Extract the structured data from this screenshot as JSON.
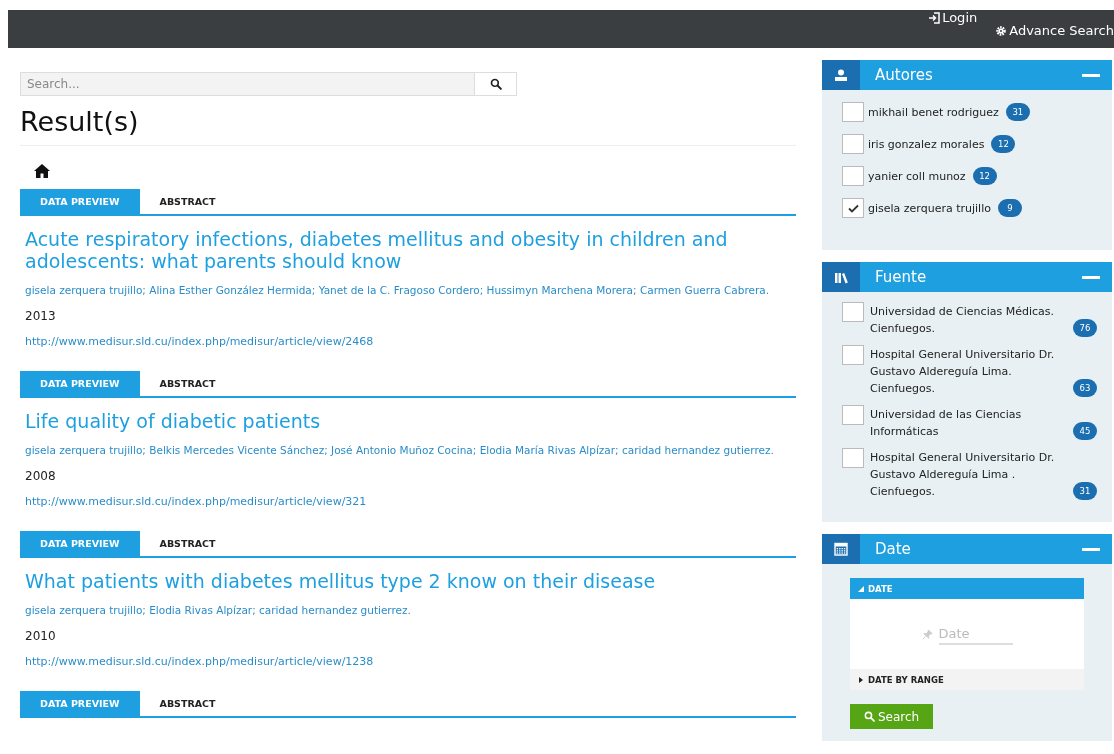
{
  "topbar": {
    "login": "Login",
    "advance_search": "Advance Search"
  },
  "search": {
    "placeholder": "Search..."
  },
  "heading": "Result(s)",
  "results": [
    {
      "tabs": [
        {
          "label": "DATA PREVIEW",
          "selected": true
        },
        {
          "label": "ABSTRACT",
          "selected": false
        }
      ],
      "title": "Acute respiratory infections, diabetes mellitus and obesity in children and adolescents: what parents should know",
      "authors": "gisela zerquera trujillo; Alina Esther González Hermida; Yanet de la C. Fragoso Cordero; Hussimyn Marchena Morera; Carmen Guerra Cabrera.",
      "year": "2013",
      "url": "http://www.medisur.sld.cu/index.php/medisur/article/view/2468"
    },
    {
      "tabs": [
        {
          "label": "DATA PREVIEW",
          "selected": true
        },
        {
          "label": "ABSTRACT",
          "selected": false
        }
      ],
      "title": "Life quality of diabetic patients",
      "authors": "gisela zerquera trujillo; Belkis Mercedes Vicente Sánchez; José Antonio Muñoz Cocina; Elodia María Rivas Alpízar; caridad hernandez gutierrez.",
      "year": "2008",
      "url": "http://www.medisur.sld.cu/index.php/medisur/article/view/321"
    },
    {
      "tabs": [
        {
          "label": "DATA PREVIEW",
          "selected": true
        },
        {
          "label": "ABSTRACT",
          "selected": false
        }
      ],
      "title": "What patients with diabetes mellitus type 2 know on their disease",
      "authors": "gisela zerquera trujillo; Elodia Rivas Alpízar; caridad hernandez gutierrez.",
      "year": "2010",
      "url": "http://www.medisur.sld.cu/index.php/medisur/article/view/1238"
    },
    {
      "tabs": [
        {
          "label": "DATA PREVIEW",
          "selected": true
        },
        {
          "label": "ABSTRACT",
          "selected": false
        }
      ]
    }
  ],
  "panels": [
    {
      "kind": "authors",
      "title": "Autores",
      "items": [
        {
          "label": "mikhail benet rodriguez",
          "count": "31",
          "checked": false
        },
        {
          "label": "iris gonzalez morales",
          "count": "12",
          "checked": false
        },
        {
          "label": "yanier coll munoz",
          "count": "12",
          "checked": false
        },
        {
          "label": "gisela zerquera trujillo",
          "count": "9",
          "checked": true
        }
      ]
    },
    {
      "kind": "sources",
      "title": "Fuente",
      "items": [
        {
          "label": "Universidad de Ciencias Médicas. Cienfuegos.",
          "count": "76",
          "checked": false
        },
        {
          "label": "Hospital General Universitario Dr. Gustavo Aldereguía Lima. Cienfuegos.",
          "count": "63",
          "checked": false
        },
        {
          "label": "Universidad de las Ciencias Informáticas",
          "count": "45",
          "checked": false
        },
        {
          "label": "Hospital General Universitario Dr. Gustavo Aldereguía Lima . Cienfuegos.",
          "count": "31",
          "checked": false
        }
      ]
    },
    {
      "kind": "date",
      "title": "Date",
      "sections": [
        {
          "label": "DATE",
          "expanded": true,
          "placeholder": "Date"
        },
        {
          "label": "DATE BY RANGE",
          "expanded": false
        }
      ],
      "button": "Search"
    }
  ]
}
